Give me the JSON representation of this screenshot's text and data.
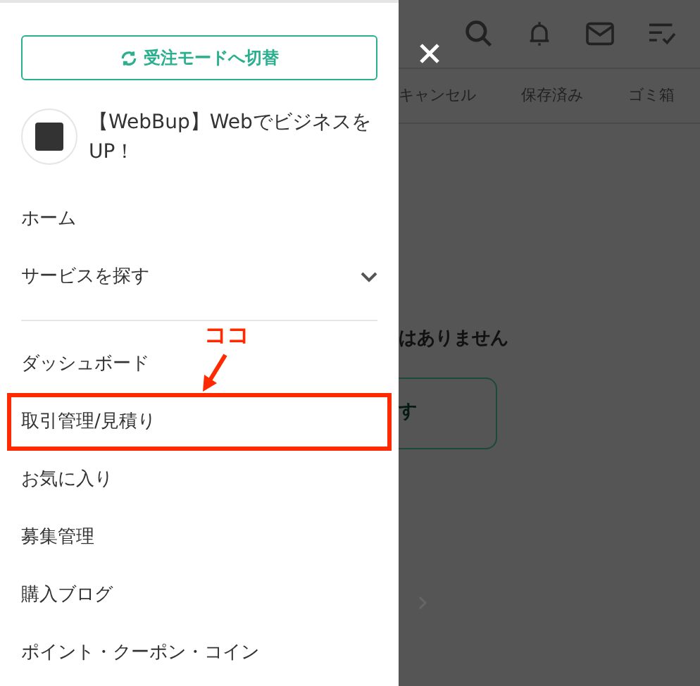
{
  "drawer": {
    "mode_button": {
      "label": "受注モードへ切替"
    },
    "profile": {
      "name": "【WebBup】Webでビジネスを UP！"
    },
    "menu_groups": [
      [
        {
          "label": "ホーム",
          "kind": "link",
          "highlighted": false
        },
        {
          "label": "サービスを探す",
          "kind": "expandable",
          "highlighted": false
        }
      ],
      [
        {
          "label": "ダッシュボード",
          "kind": "link",
          "highlighted": false
        },
        {
          "label": "取引管理/見積り",
          "kind": "link",
          "highlighted": true
        },
        {
          "label": "お気に入り",
          "kind": "link",
          "highlighted": false
        },
        {
          "label": "募集管理",
          "kind": "link",
          "highlighted": false
        },
        {
          "label": "購入ブログ",
          "kind": "link",
          "highlighted": false
        },
        {
          "label": "ポイント・クーポン・コイン",
          "kind": "link",
          "highlighted": false
        }
      ]
    ]
  },
  "annotation": {
    "text": "ココ"
  },
  "background_page": {
    "tabs": [
      "キャンセル",
      "保存済み",
      "ゴミ箱"
    ],
    "empty_message": "はありません",
    "button_label": "す"
  }
}
